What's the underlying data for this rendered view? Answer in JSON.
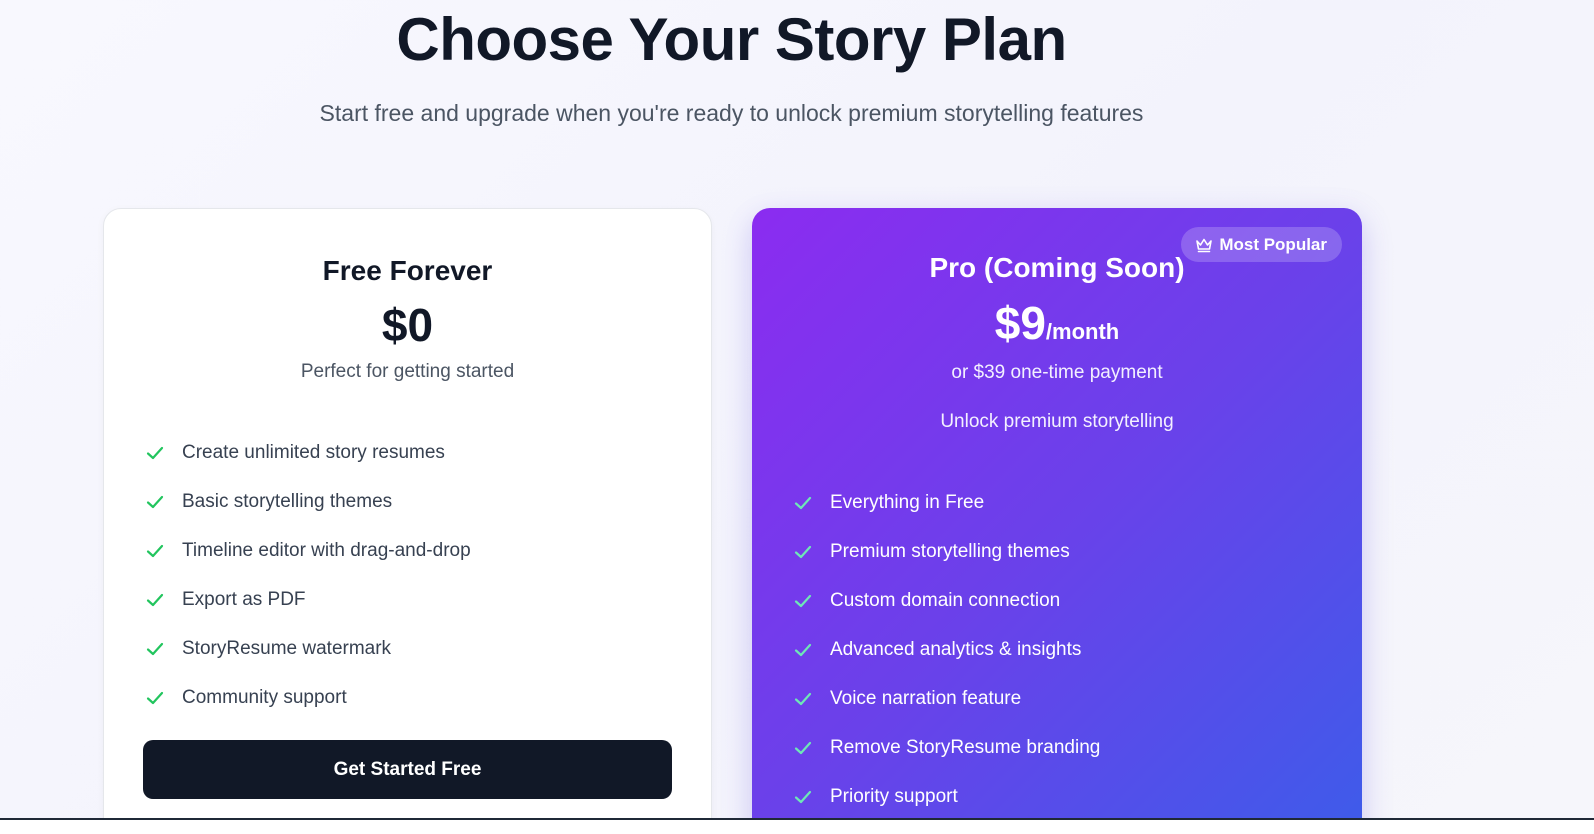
{
  "header": {
    "title": "Choose Your Story Plan",
    "subtitle": "Start free and upgrade when you're ready to unlock premium storytelling features"
  },
  "plans": {
    "free": {
      "name": "Free Forever",
      "price": "$0",
      "note": "Perfect for getting started",
      "features": [
        "Create unlimited story resumes",
        "Basic storytelling themes",
        "Timeline editor with drag-and-drop",
        "Export as PDF",
        "StoryResume watermark",
        "Community support"
      ],
      "cta_label": "Get Started Free"
    },
    "pro": {
      "badge": "Most Popular",
      "name": "Pro (Coming Soon)",
      "price": "$9",
      "price_period": "/month",
      "note": "or $39 one-time payment",
      "tagline": "Unlock premium storytelling",
      "features": [
        "Everything in Free",
        "Premium storytelling themes",
        "Custom domain connection",
        "Advanced analytics & insights",
        "Voice narration feature",
        "Remove StoryResume branding",
        "Priority support"
      ]
    }
  },
  "icons": {
    "check": "check-icon",
    "crown": "crown-icon"
  },
  "colors": {
    "check_free": "#22c55e",
    "check_pro": "#6ee7b7",
    "pro_gradient_start": "#8b2cf0",
    "pro_gradient_end": "#3d5cea",
    "cta_background": "#111827"
  }
}
